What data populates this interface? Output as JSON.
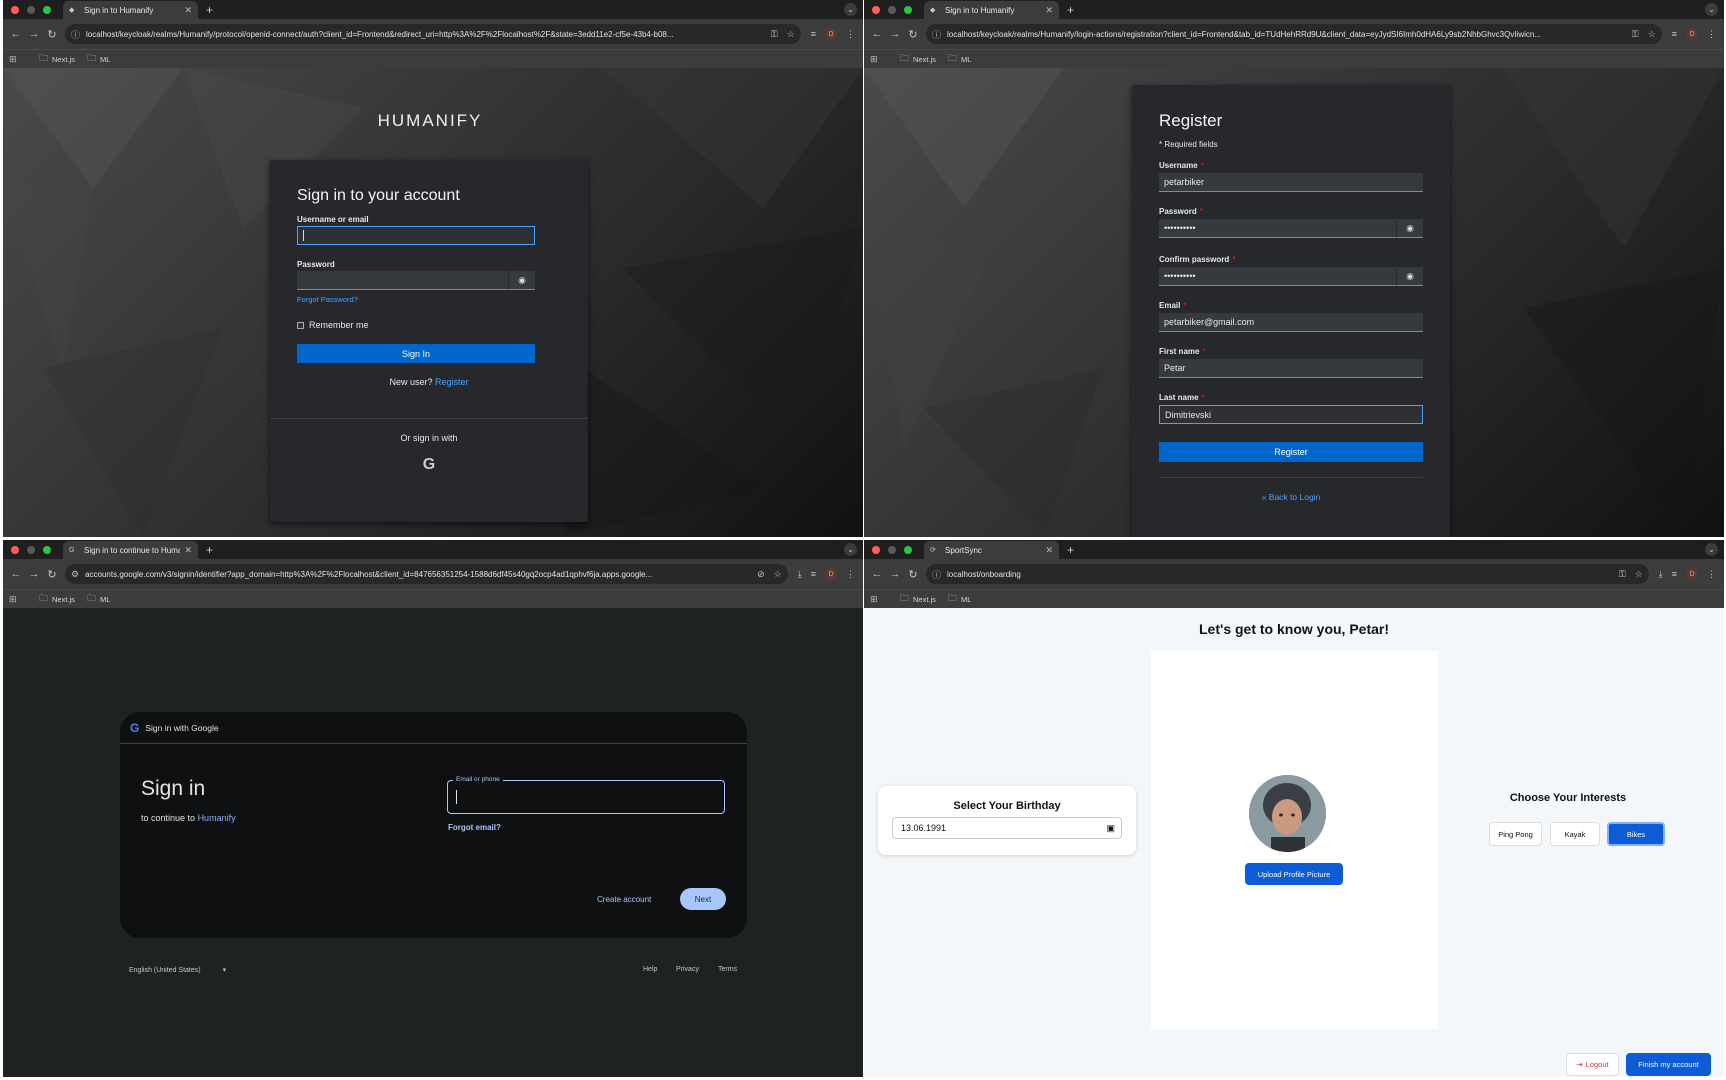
{
  "q1": {
    "tab": "Sign in to Humanify",
    "url": "localhost/keycloak/realms/Humanify/protocol/openid-connect/auth?client_id=Frontend&redirect_uri=http%3A%2F%2Flocalhost%2F&state=3edd11e2-cf5e-43b4-b08...",
    "bookmarks": [
      "Next.js",
      "ML"
    ],
    "brand": "HUMANIFY",
    "title": "Sign in to your account",
    "username_label": "Username or email",
    "password_label": "Password",
    "forgot": "Forgot Password?",
    "remember": "Remember me",
    "signin": "Sign In",
    "new_user": "New user?",
    "register_link": "Register",
    "or_sign": "Or sign in with",
    "google_glyph": "G"
  },
  "q2": {
    "tab": "Sign in to Humanify",
    "url": "localhost/keycloak/realms/Humanify/login-actions/registration?client_id=Frontend&tab_id=TUdHehRRd9U&client_data=eyJydSI6Imh0dHA6Ly9sb2NhbGhvc3QvIiwicn...",
    "bookmarks": [
      "Next.js",
      "ML"
    ],
    "title": "Register",
    "required_note": "* Required fields",
    "fields": {
      "username": {
        "label": "Username",
        "value": "petarbiker"
      },
      "password": {
        "label": "Password",
        "value": "••••••••••"
      },
      "confirm": {
        "label": "Confirm password",
        "value": "••••••••••"
      },
      "email": {
        "label": "Email",
        "value": "petarbiker@gmail.com"
      },
      "first": {
        "label": "First name",
        "value": "Petar"
      },
      "last": {
        "label": "Last name",
        "value": "Dimitrievski"
      }
    },
    "register_btn": "Register",
    "back": "« Back to Login"
  },
  "q3": {
    "tab": "Sign in to continue to Human...",
    "url": "accounts.google.com/v3/signin/identifier?app_domain=http%3A%2F%2Flocalhost&client_id=847656351254-1588d6df45s40gq2ocp4ad1qphvf6ja.apps.google...",
    "bookmarks": [
      "Next.js",
      "ML"
    ],
    "header": "Sign in with Google",
    "title": "Sign in",
    "subtitle_prefix": "to continue to",
    "subtitle_app": "Humanify",
    "field_label": "Email or phone",
    "forgot": "Forgot email?",
    "create": "Create account",
    "next": "Next",
    "language": "English (United States)",
    "footer_links": [
      "Help",
      "Privacy",
      "Terms"
    ]
  },
  "q4": {
    "tab": "SportSync",
    "url": "localhost/onboarding",
    "bookmarks": [
      "Next.js",
      "ML"
    ],
    "title": "Let's get to know you, Petar!",
    "birthday_title": "Select Your Birthday",
    "birthday_value": "13.06.1991",
    "upload": "Upload Profile Picture",
    "interests_title": "Choose Your Interests",
    "interests": [
      "Ping Pong",
      "Kayak",
      "Bikes"
    ],
    "selected_interest": "Bikes",
    "logout": "Logout",
    "finish": "Finish my account"
  },
  "colors": {
    "accent": "#0066cc",
    "google_accent": "#a8c7fa",
    "onboard_blue": "#0d5cd6"
  }
}
